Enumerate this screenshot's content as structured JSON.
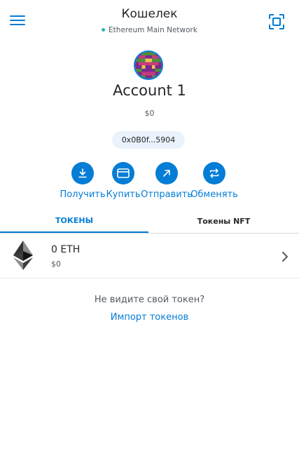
{
  "header": {
    "title": "Кошелек",
    "network": "Ethereum Main Network",
    "menu_icon": "hamburger-menu-icon",
    "scan_icon": "qr-scan-icon"
  },
  "account": {
    "name": "Account 1",
    "balance": "$0",
    "address": "0x0B0f...5904"
  },
  "actions": [
    {
      "label": "Получить",
      "icon": "receive-icon"
    },
    {
      "label": "Купить",
      "icon": "card-icon"
    },
    {
      "label": "Отправить",
      "icon": "send-arrow-icon"
    },
    {
      "label": "Обменять",
      "icon": "swap-icon"
    }
  ],
  "tabs": [
    {
      "label": "ТОКЕНЫ",
      "active": true
    },
    {
      "label": "Токены NFT",
      "active": false
    }
  ],
  "tokens": [
    {
      "amount": "0 ETH",
      "fiat": "$0",
      "icon": "ethereum-icon"
    }
  ],
  "footer": {
    "no_token_text": "Не видите свой токен?",
    "import_link": "Импорт токенов"
  },
  "colors": {
    "accent": "#037dd6",
    "network_dot": "#29b6af",
    "pill_bg": "#eaf3fb"
  }
}
